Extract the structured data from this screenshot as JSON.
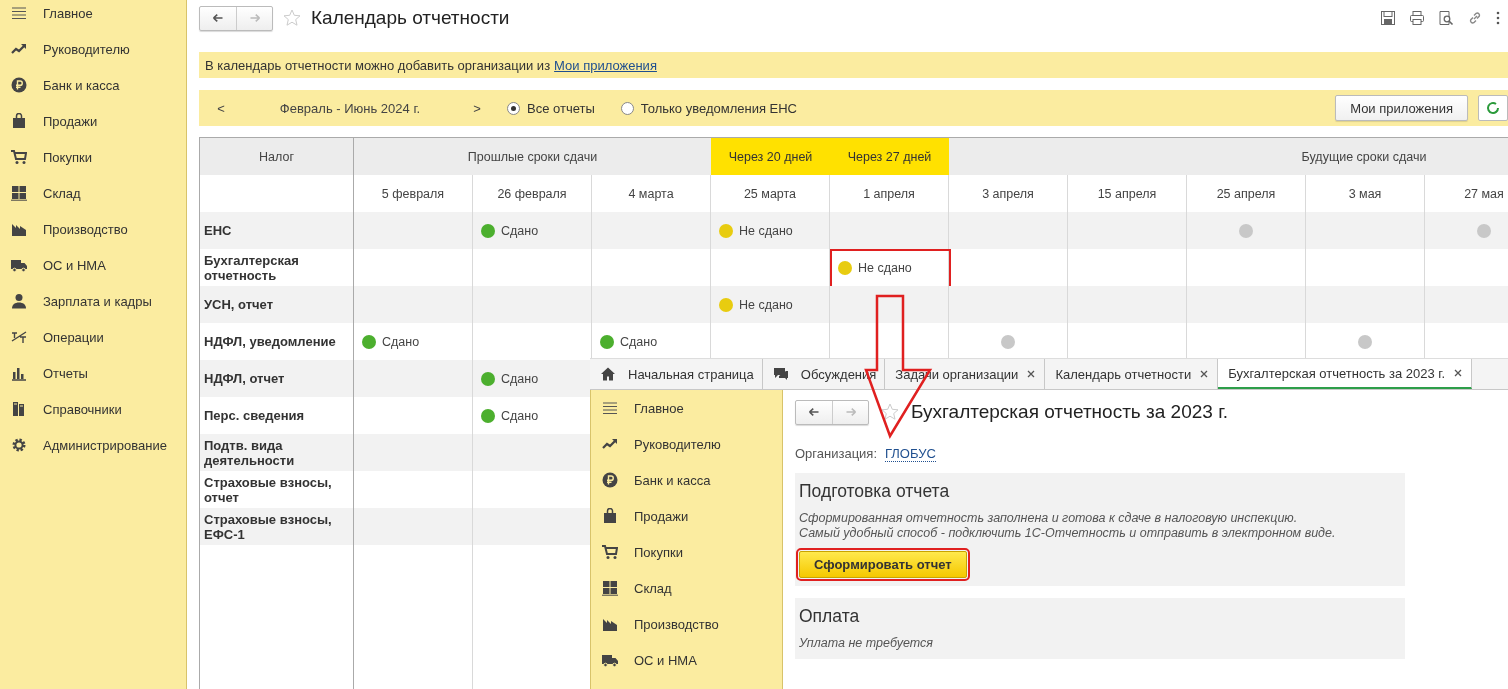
{
  "sidebar": {
    "items": [
      "Главное",
      "Руководителю",
      "Банк и касса",
      "Продажи",
      "Покупки",
      "Склад",
      "Производство",
      "ОС и НМА",
      "Зарплата и кадры",
      "Операции",
      "Отчеты",
      "Справочники",
      "Администрирование"
    ]
  },
  "header": {
    "title": "Календарь отчетности",
    "forward_disabled": true
  },
  "info_bar": {
    "text": "В календарь отчетности можно добавить организации из",
    "link": "Мои приложения"
  },
  "period_bar": {
    "prev": "<",
    "period": "Февраль - Июнь 2024 г.",
    "next": ">",
    "filters": [
      {
        "label": "Все отчеты",
        "selected": true
      },
      {
        "label": "Только уведомления ЕНС",
        "selected": false
      }
    ],
    "button": "Мои приложения"
  },
  "table": {
    "tax_heading": "Налог",
    "groups": [
      {
        "label": "Прошлые сроки сдачи",
        "highlighted": false,
        "dates": [
          "5 февраля",
          "26 февраля",
          "4 марта"
        ]
      },
      {
        "label": "Через 20 дней",
        "highlighted": true,
        "dates": [
          "25 марта"
        ]
      },
      {
        "label": "Через 27 дней",
        "highlighted": true,
        "dates": [
          "1 апреля"
        ]
      },
      {
        "label": "Будущие сроки сдачи",
        "highlighted": false,
        "dates": [
          "3 апреля",
          "15 апреля",
          "25 апреля",
          "3 мая",
          "27 мая"
        ]
      }
    ],
    "rows": [
      {
        "name": "ЕНС",
        "cells": [
          null,
          {
            "color": "#4caf2e",
            "text": "Сдано"
          },
          null,
          {
            "color": "#e8cc10",
            "text": "Не сдано"
          },
          null,
          null,
          null,
          {
            "color": "#c8c8c8"
          },
          null,
          {
            "color": "#c8c8c8"
          }
        ]
      },
      {
        "name": "Бухгалтерская отчетность",
        "cells": [
          null,
          null,
          null,
          null,
          {
            "color": "#e8cc10",
            "text": "Не сдано",
            "marked": true
          }
        ]
      },
      {
        "name": "УСН, отчет",
        "cells": [
          null,
          null,
          null,
          {
            "color": "#e8cc10",
            "text": "Не сдано"
          }
        ]
      },
      {
        "name": "НДФЛ, уведомление",
        "cells": [
          {
            "color": "#4caf2e",
            "text": "Сдано"
          },
          null,
          {
            "color": "#4caf2e",
            "text": "Сдано"
          },
          null,
          null,
          {
            "color": "#c8c8c8"
          },
          null,
          null,
          {
            "color": "#c8c8c8"
          }
        ]
      },
      {
        "name": "НДФЛ, отчет",
        "cells": [
          null,
          {
            "color": "#4caf2e",
            "text": "Сдано"
          }
        ]
      },
      {
        "name": "Перс. сведения",
        "cells": [
          null,
          {
            "color": "#4caf2e",
            "text": "Сдано"
          }
        ]
      },
      {
        "name": "Подтв. вида деятельности",
        "cells": []
      },
      {
        "name": "Страховые взносы, отчет",
        "cells": []
      },
      {
        "name": "Страховые взносы, ЕФС-1",
        "cells": []
      }
    ]
  },
  "inset_window": {
    "tabs": [
      {
        "label": "Начальная страница",
        "selected": false,
        "closable": false
      },
      {
        "label": "Обсуждения",
        "selected": false,
        "closable": false
      },
      {
        "label": "Задачи организации",
        "selected": false,
        "closable": true
      },
      {
        "label": "Календарь отчетности",
        "selected": false,
        "closable": true
      },
      {
        "label": "Бухгалтерская отчетность за 2023 г.",
        "selected": true,
        "closable": true
      }
    ],
    "sidebar": {
      "items": [
        "Главное",
        "Руководителю",
        "Банк и касса",
        "Продажи",
        "Покупки",
        "Склад",
        "Производство",
        "ОС и НМА"
      ]
    },
    "forward_disabled": true,
    "title": "Бухгалтерская отчетность за 2023 г.",
    "organization": {
      "label": "Организация:",
      "value": "ГЛОБУС"
    },
    "panels": [
      {
        "title": "Подготовка отчета",
        "text": [
          "Сформированная отчетность заполнена и готова к сдаче в налоговую инспекцию.",
          "Самый удобный способ - подключить 1С-Отчетность и отправить в электронном виде."
        ],
        "button": {
          "label": "Сформировать отчет",
          "highlighted": true
        }
      },
      {
        "title": "Оплата",
        "text": [
          "Уплата не требуется"
        ]
      }
    ]
  }
}
